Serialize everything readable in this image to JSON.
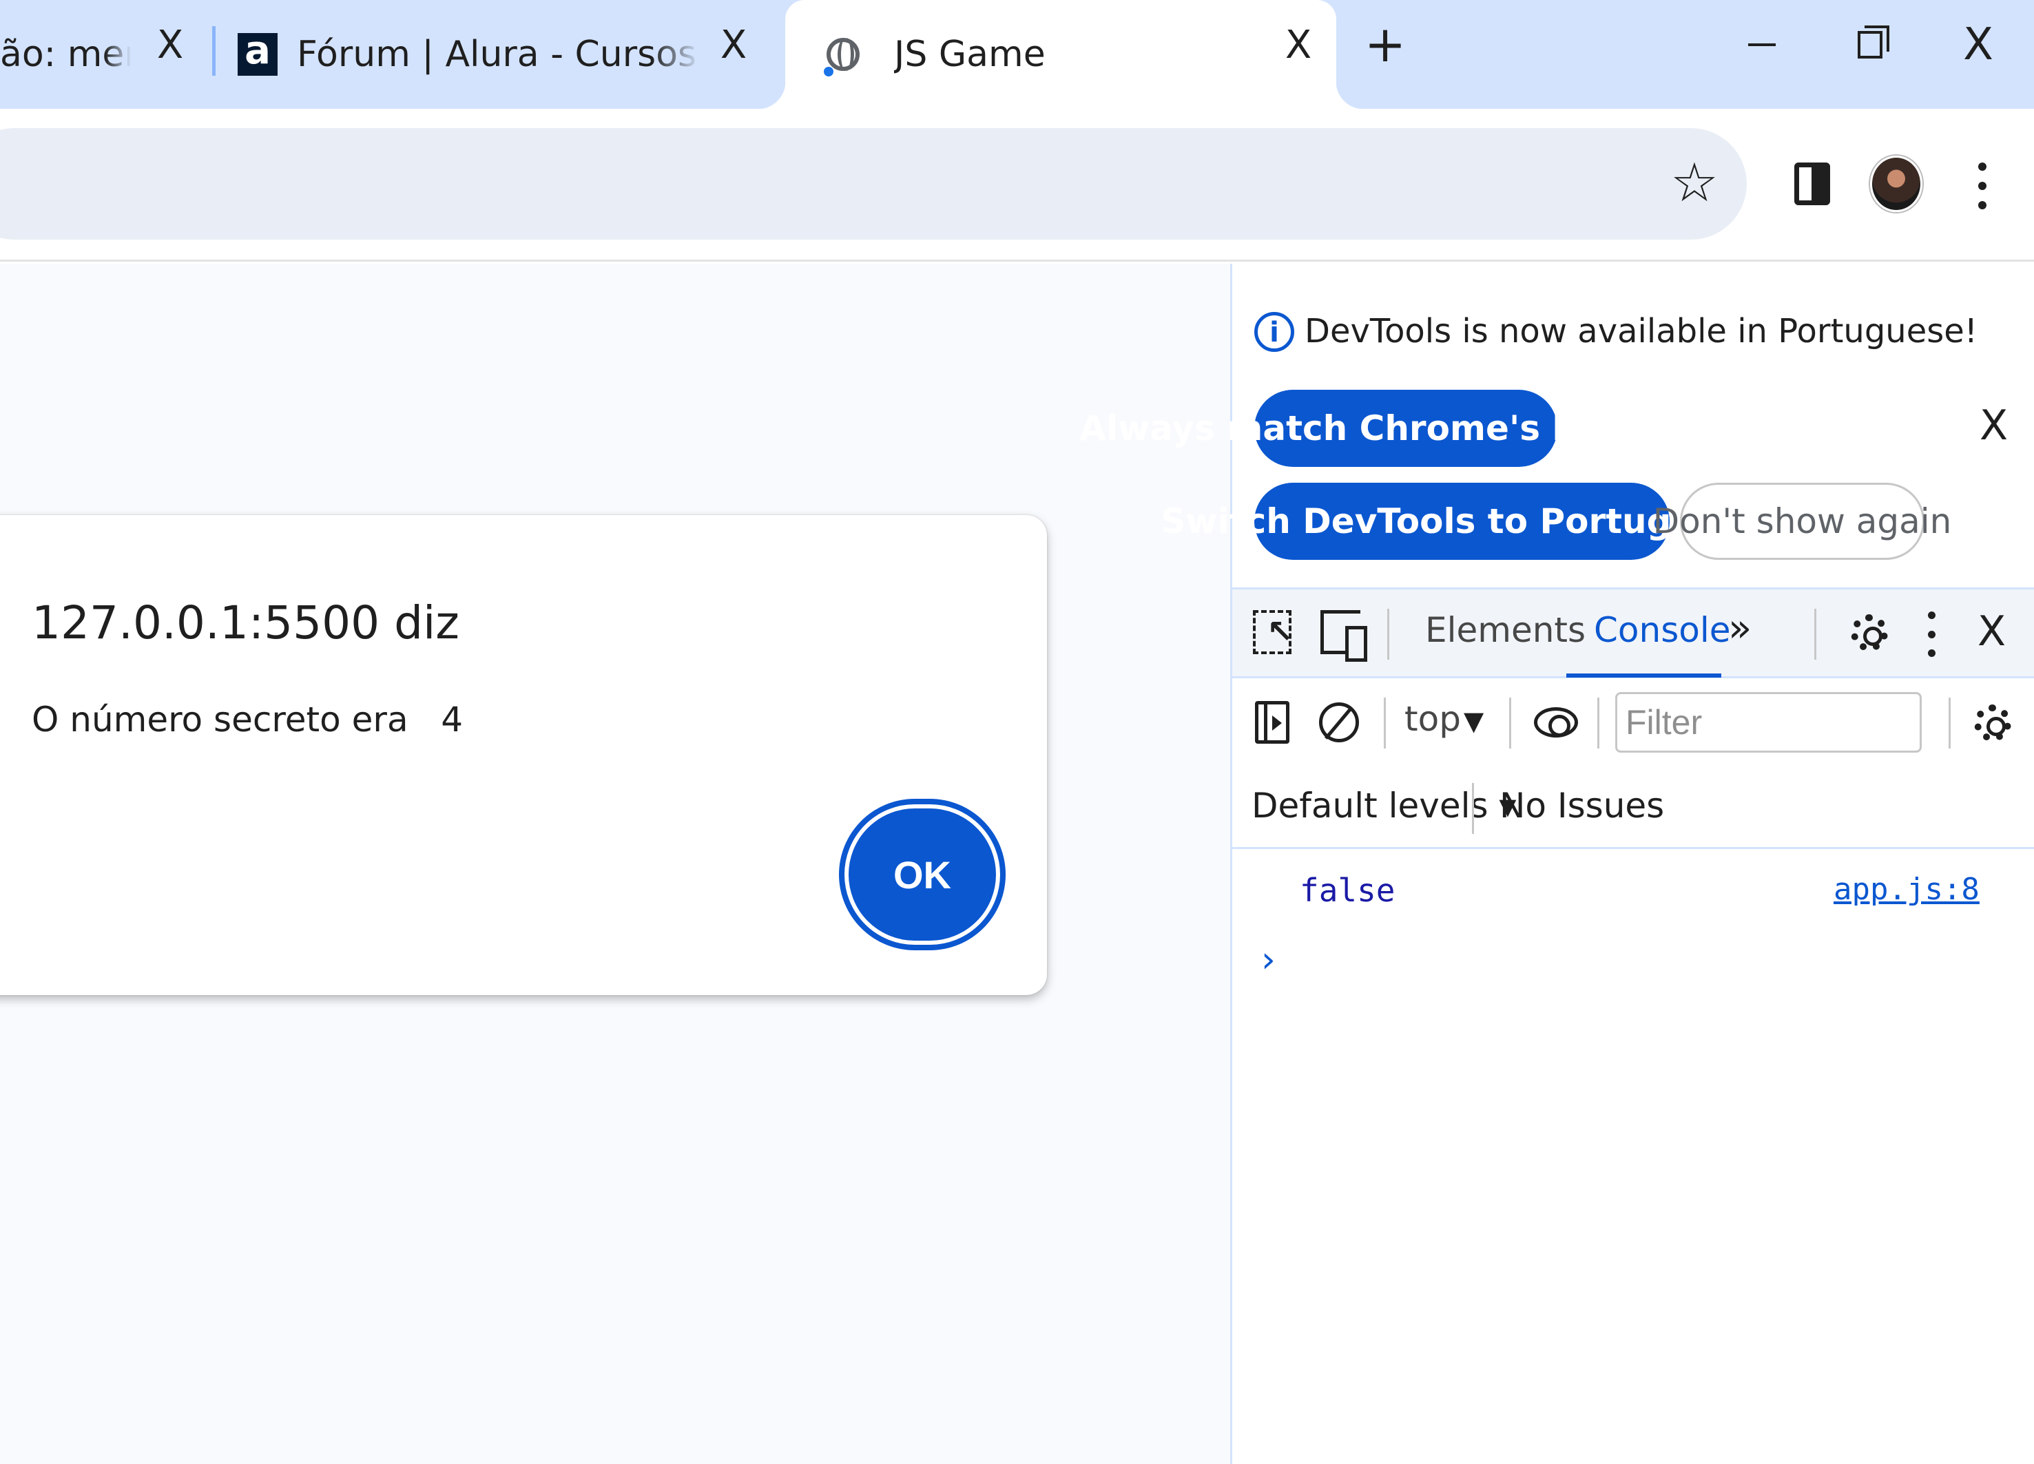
{
  "tabs": [
    {
      "title": "ão: mergulhe em programação",
      "close": "X"
    },
    {
      "favicon_letter": "a",
      "title": "Fórum | Alura - Cursos online de tecnologia",
      "close": "X"
    },
    {
      "title": "JS Game",
      "close": "X",
      "active": true
    }
  ],
  "new_tab": "+",
  "window_close": "X",
  "toolbar": {
    "star": "☆"
  },
  "dialog": {
    "title": "127.0.0.1:5500 diz",
    "message": "O número secreto era   4",
    "ok_label": "OK"
  },
  "devtools": {
    "info_icon": "i",
    "info_text": "DevTools is now available in Portuguese!",
    "always_match": "Always match Chrome's language",
    "switch": "Switch DevTools to Portuguese",
    "dont_show": "Don't show again",
    "info_close": "X",
    "tabs": {
      "elements": "Elements",
      "console": "Console",
      "more": "»"
    },
    "close": "X",
    "context": "top",
    "context_caret": "▼",
    "filter_placeholder": "Filter",
    "levels": "Default levels ▾",
    "issues": "No Issues",
    "log": {
      "value": "false",
      "source": "app.js:8"
    },
    "prompt": "›"
  },
  "colors": {
    "accent": "#0b57d0",
    "tabstrip": "#d3e3fd",
    "omnibox": "#e9eef6"
  }
}
